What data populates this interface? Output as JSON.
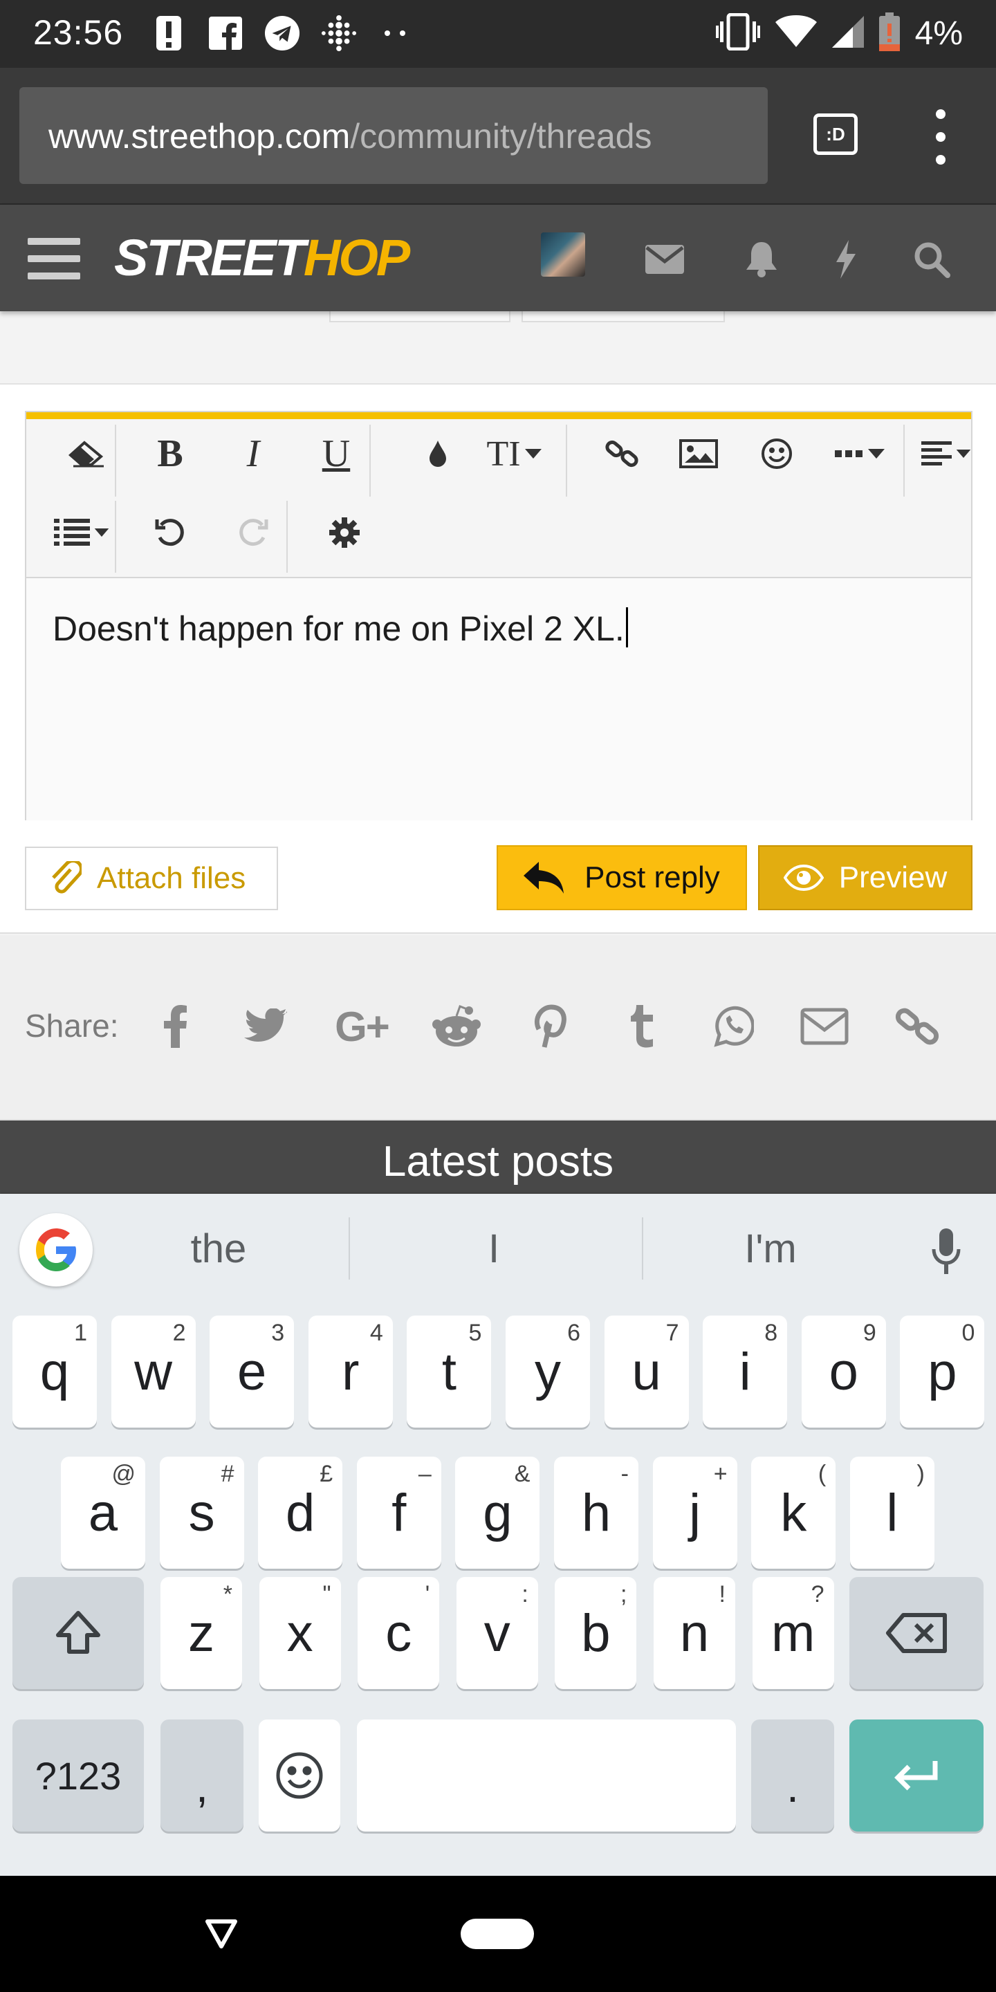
{
  "status_bar": {
    "time": "23:56",
    "battery": "4%",
    "left_icons": [
      "alert-icon",
      "facebook-icon",
      "telegram-icon",
      "fitbit-icon",
      "more-dots-icon"
    ],
    "right_icons": [
      "vibrate-icon",
      "wifi-icon",
      "signal-icon",
      "battery-low-icon"
    ]
  },
  "browser": {
    "url_domain": "www.streethop.com",
    "url_path": "/community/threads",
    "tab_button_label": ":D"
  },
  "site_header": {
    "logo_part1": "STREET",
    "logo_part2": "HOP",
    "icons": [
      "menu-icon",
      "avatar",
      "mail-icon",
      "bell-icon",
      "lightning-icon",
      "search-icon"
    ]
  },
  "editor": {
    "toolbar": [
      "eraser-icon",
      "bold-icon",
      "italic-icon",
      "underline-icon",
      "color-drop-icon",
      "text-size-icon",
      "link-icon",
      "image-icon",
      "smiley-icon",
      "more-icon",
      "align-icon",
      "list-icon",
      "undo-icon",
      "redo-icon",
      "gear-icon"
    ],
    "bold_label": "B",
    "italic_label": "I",
    "underline_label": "U",
    "text_size_label": "TI",
    "content": "Doesn't happen for me on Pixel 2 XL."
  },
  "actions": {
    "attach_label": "Attach files",
    "reply_label": "Post reply",
    "preview_label": "Preview"
  },
  "share": {
    "label": "Share:",
    "google_plus_label": "G+",
    "icons": [
      "facebook-icon",
      "twitter-icon",
      "google-plus-icon",
      "reddit-icon",
      "pinterest-icon",
      "tumblr-icon",
      "whatsapp-icon",
      "email-icon",
      "link-icon"
    ]
  },
  "latest": {
    "title": "Latest posts"
  },
  "keyboard": {
    "suggestions": [
      "the",
      "I",
      "I'm"
    ],
    "row1": [
      {
        "k": "q",
        "h": "1"
      },
      {
        "k": "w",
        "h": "2"
      },
      {
        "k": "e",
        "h": "3"
      },
      {
        "k": "r",
        "h": "4"
      },
      {
        "k": "t",
        "h": "5"
      },
      {
        "k": "y",
        "h": "6"
      },
      {
        "k": "u",
        "h": "7"
      },
      {
        "k": "i",
        "h": "8"
      },
      {
        "k": "o",
        "h": "9"
      },
      {
        "k": "p",
        "h": "0"
      }
    ],
    "row2": [
      {
        "k": "a",
        "h": "@"
      },
      {
        "k": "s",
        "h": "#"
      },
      {
        "k": "d",
        "h": "£"
      },
      {
        "k": "f",
        "h": "–"
      },
      {
        "k": "g",
        "h": "&"
      },
      {
        "k": "h",
        "h": "-"
      },
      {
        "k": "j",
        "h": "+"
      },
      {
        "k": "k",
        "h": "("
      },
      {
        "k": "l",
        "h": ")"
      }
    ],
    "row3": [
      {
        "k": "z",
        "h": "*"
      },
      {
        "k": "x",
        "h": "\""
      },
      {
        "k": "c",
        "h": "'"
      },
      {
        "k": "v",
        "h": ":"
      },
      {
        "k": "b",
        "h": ";"
      },
      {
        "k": "n",
        "h": "!"
      },
      {
        "k": "m",
        "h": "?"
      }
    ],
    "symbols_label": "?123",
    "comma_label": ",",
    "period_label": "."
  },
  "colors": {
    "accent": "#fbbd0e",
    "header": "#4a4a4a",
    "enter_key": "#5fbab0"
  }
}
